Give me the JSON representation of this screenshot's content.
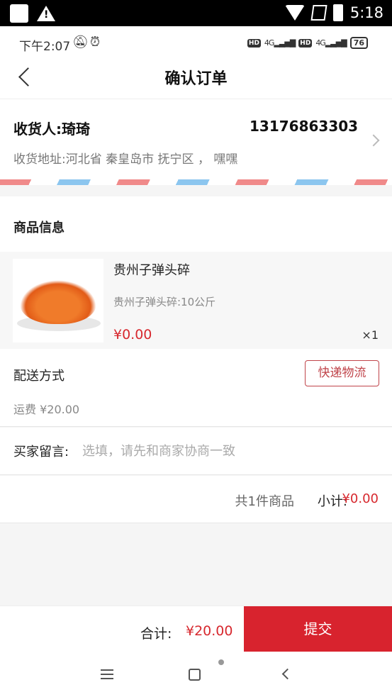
{
  "system_status": {
    "time": "5:18"
  },
  "phone_status": {
    "time": "下午2:07",
    "battery": "76"
  },
  "header": {
    "title": "确认订单"
  },
  "address": {
    "receiver": "收货人:琦琦",
    "phone": "13176863303",
    "detail": "收货地址:河北省 秦皇岛市 抚宁区 ， 嘿嘿"
  },
  "goods": {
    "section_title": "商品信息",
    "name": "贵州子弹头碎",
    "spec": "贵州子弹头碎:10公斤",
    "price": "¥0.00",
    "qty": "×1"
  },
  "delivery": {
    "label": "配送方式",
    "method_button": "快递物流",
    "fee": "运费 ¥20.00"
  },
  "message": {
    "label": "买家留言:",
    "placeholder": "选填，请先和商家协商一致"
  },
  "subtotal": {
    "count_text": "共1件商品",
    "label": "小计:",
    "value": "¥0.00"
  },
  "footer": {
    "total_label": "合计:",
    "total_value": "¥20.00",
    "submit_label": "提交"
  },
  "colors": {
    "accent": "#d8232e",
    "price": "#d7282e"
  }
}
